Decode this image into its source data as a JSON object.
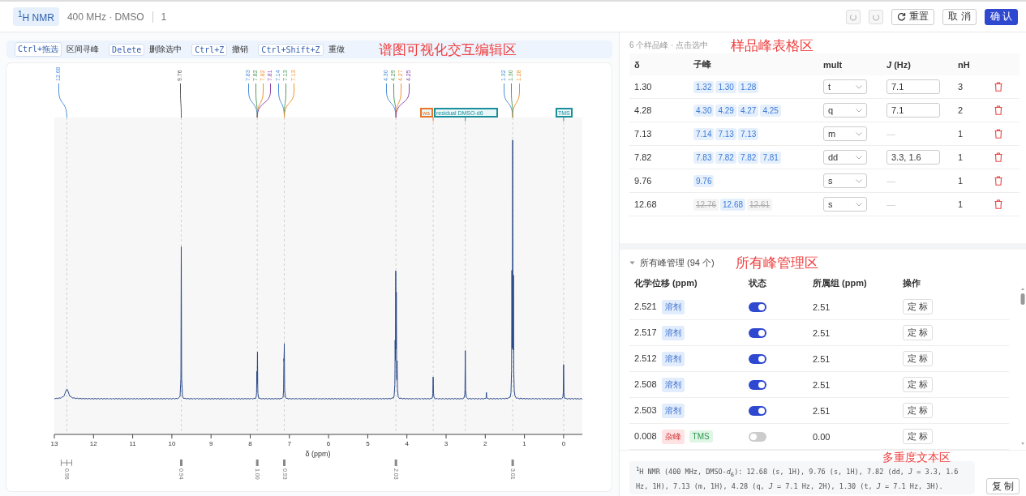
{
  "header": {
    "nucleus": "$^{1}$H NMR",
    "info": "400 MHz · DMSO",
    "index": "1",
    "undo": {
      "disabled": true
    },
    "redo": {
      "disabled": true
    },
    "reset": "重置",
    "cancel": "取 消",
    "confirm": "确 认"
  },
  "editor": {
    "shortcuts": [
      {
        "key": "Ctrl+拖选",
        "action": "区间寻峰"
      },
      {
        "key": "Delete",
        "action": "删除选中"
      },
      {
        "key": "Ctrl+Z",
        "action": "撤销"
      },
      {
        "key": "Ctrl+Shift+Z",
        "action": "重做"
      }
    ],
    "annotation": "谱图可视化交互编辑区",
    "peak_labels": [
      {
        "label": "12.68",
        "color": "#4a8fd8"
      },
      {
        "label": "9.76",
        "color": "#555555"
      },
      {
        "label": "7.83",
        "color": "#4a8fd8"
      },
      {
        "label": "7.82",
        "color": "#4f9a5a"
      },
      {
        "label": "7.82",
        "color": "#f0922e"
      },
      {
        "label": "7.81",
        "color": "#8e44ad"
      },
      {
        "label": "7.14",
        "color": "#4a8fd8"
      },
      {
        "label": "7.13",
        "color": "#4f9a5a"
      },
      {
        "label": "7.13",
        "color": "#f0922e"
      },
      {
        "label": "4.30",
        "color": "#4a8fd8"
      },
      {
        "label": "4.29",
        "color": "#4f9a5a"
      },
      {
        "label": "4.27",
        "color": "#f0922e"
      },
      {
        "label": "4.25",
        "color": "#8e44ad"
      },
      {
        "label": "1.32",
        "color": "#4a8fd8"
      },
      {
        "label": "1.30",
        "color": "#4f9a5a"
      },
      {
        "label": "1.28",
        "color": "#f0922e"
      }
    ],
    "tags": [
      {
        "label": "wa",
        "color": "#e8742a"
      },
      {
        "label": "residual DMSO-d6",
        "color": "#1a8f9c"
      },
      {
        "label": "TMS",
        "color": "#1a8f9c"
      }
    ],
    "axis": {
      "label": "δ (ppm)",
      "ticks": [
        "13",
        "12",
        "11",
        "10",
        "9",
        "8",
        "7",
        "6",
        "5",
        "4",
        "3",
        "2",
        "1",
        "0"
      ]
    },
    "integrals": [
      "0.96",
      "0.94",
      "1.00",
      "0.93",
      "2.03",
      "3.01"
    ]
  },
  "sample_peaks": {
    "caption": "6 个样品峰 · 点击选中",
    "annotation": "样品峰表格区",
    "columns": [
      "δ",
      "子峰",
      "mult",
      "*J* (Hz)",
      "nH"
    ],
    "rows": [
      {
        "shift": "1.30",
        "subpeaks": [
          {
            "label": "1.32",
            "excluded": false
          },
          {
            "label": "1.30",
            "excluded": false
          },
          {
            "label": "1.28",
            "excluded": false
          }
        ],
        "mult": "t",
        "j": "7.1",
        "j_field": true,
        "nh": "3"
      },
      {
        "shift": "4.28",
        "subpeaks": [
          {
            "label": "4.30",
            "excluded": false
          },
          {
            "label": "4.29",
            "excluded": false
          },
          {
            "label": "4.27",
            "excluded": false
          },
          {
            "label": "4.25",
            "excluded": false
          }
        ],
        "mult": "q",
        "j": "7.1",
        "j_field": true,
        "nh": "2"
      },
      {
        "shift": "7.13",
        "subpeaks": [
          {
            "label": "7.14",
            "excluded": false
          },
          {
            "label": "7.13",
            "excluded": false
          },
          {
            "label": "7.13",
            "excluded": false
          }
        ],
        "mult": "m",
        "j": "—",
        "j_field": false,
        "nh": "1"
      },
      {
        "shift": "7.82",
        "subpeaks": [
          {
            "label": "7.83",
            "excluded": false
          },
          {
            "label": "7.82",
            "excluded": false
          },
          {
            "label": "7.82",
            "excluded": false
          },
          {
            "label": "7.81",
            "excluded": false
          }
        ],
        "mult": "dd",
        "j": "3.3, 1.6",
        "j_field": true,
        "nh": "1"
      },
      {
        "shift": "9.76",
        "subpeaks": [
          {
            "label": "9.76",
            "excluded": false
          }
        ],
        "mult": "s",
        "j": "—",
        "j_field": false,
        "nh": "1"
      },
      {
        "shift": "12.68",
        "subpeaks": [
          {
            "label": "12.76",
            "excluded": true
          },
          {
            "label": "12.68",
            "excluded": false
          },
          {
            "label": "12.61",
            "excluded": true
          }
        ],
        "mult": "s",
        "j": "—",
        "j_field": false,
        "nh": "1"
      }
    ]
  },
  "all_peaks": {
    "title": "所有峰管理 (94 个)",
    "expanded": true,
    "annotation": "所有峰管理区",
    "columns": [
      "化学位移 (ppm)",
      "状态",
      "所属组 (ppm)",
      "操作"
    ],
    "rows": [
      {
        "shift": "2.521",
        "tags": [
          {
            "label": "溶剂",
            "kind": "solvent"
          }
        ],
        "on": true,
        "group": "2.51",
        "action": "定 标"
      },
      {
        "shift": "2.517",
        "tags": [
          {
            "label": "溶剂",
            "kind": "solvent"
          }
        ],
        "on": true,
        "group": "2.51",
        "action": "定 标"
      },
      {
        "shift": "2.512",
        "tags": [
          {
            "label": "溶剂",
            "kind": "solvent"
          }
        ],
        "on": true,
        "group": "2.51",
        "action": "定 标"
      },
      {
        "shift": "2.508",
        "tags": [
          {
            "label": "溶剂",
            "kind": "solvent"
          }
        ],
        "on": true,
        "group": "2.51",
        "action": "定 标"
      },
      {
        "shift": "2.503",
        "tags": [
          {
            "label": "溶剂",
            "kind": "solvent"
          }
        ],
        "on": true,
        "group": "2.51",
        "action": "定 标"
      },
      {
        "shift": "0.008",
        "tags": [
          {
            "label": "杂峰",
            "kind": "impurity"
          },
          {
            "label": "TMS",
            "kind": "reference"
          }
        ],
        "on": false,
        "group": "0.00",
        "action": "定 标"
      }
    ]
  },
  "multiplicity_text": {
    "text": "$^{1}$H NMR (400 MHz, DMSO-*d*$_{6}$): 12.68 (s, 1H), 9.76 (s, 1H), 7.82 (dd, *J* = 3.3, 1.6 Hz, 1H), 7.13 (m, 1H), 4.28 (q, *J* = 7.1 Hz, 2H), 1.30 (t, *J* = 7.1 Hz, 3H).",
    "annotation": "多重度文本区",
    "copy": "复 制"
  }
}
